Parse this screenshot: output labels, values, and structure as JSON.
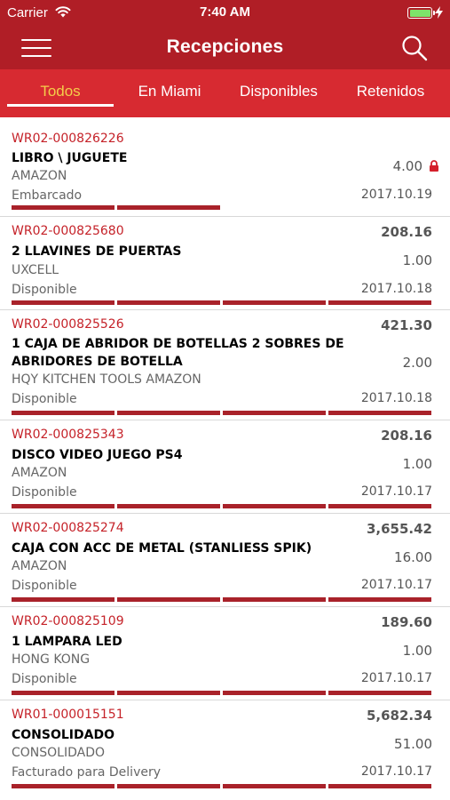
{
  "status_bar": {
    "carrier": "Carrier",
    "time": "7:40 AM",
    "battery_color": "#7de36a"
  },
  "header": {
    "title": "Recepciones",
    "menu_icon": "hamburger-menu-icon",
    "search_icon": "search-icon",
    "background_color": "#b01e26"
  },
  "tabs": [
    {
      "label": "Todos",
      "active": true
    },
    {
      "label": "En Miami",
      "active": false
    },
    {
      "label": "Disponibles",
      "active": false
    },
    {
      "label": "Retenidos",
      "active": false
    }
  ],
  "colors": {
    "tab_bar": "#d72a31",
    "active_tab_text": "#f4cd4a",
    "code_text": "#c52229",
    "progress": "#a9222a"
  },
  "receptions": [
    {
      "code": "WR02-000826226",
      "description": "LIBRO \\ JUGUETE",
      "supplier": "AMAZON",
      "status": "Embarcado",
      "amount": "",
      "quantity": "4.00",
      "locked": true,
      "date": "2017.10.19",
      "progress_steps": 2
    },
    {
      "code": "WR02-000825680",
      "description": "2 LLAVINES DE PUERTAS",
      "supplier": "UXCELL",
      "status": "Disponible",
      "amount": "208.16",
      "quantity": "1.00",
      "locked": false,
      "date": "2017.10.18",
      "progress_steps": 4
    },
    {
      "code": "WR02-000825526",
      "description": "1 CAJA DE ABRIDOR DE BOTELLAS 2 SOBRES DE ABRIDORES DE BOTELLA",
      "supplier": "HQY KITCHEN TOOLS AMAZON",
      "status": "Disponible",
      "amount": "421.30",
      "quantity": "2.00",
      "locked": false,
      "date": "2017.10.18",
      "progress_steps": 4
    },
    {
      "code": "WR02-000825343",
      "description": "DISCO VIDEO JUEGO PS4",
      "supplier": "AMAZON",
      "status": "Disponible",
      "amount": "208.16",
      "quantity": "1.00",
      "locked": false,
      "date": "2017.10.17",
      "progress_steps": 4
    },
    {
      "code": "WR02-000825274",
      "description": "CAJA CON ACC DE METAL (STANLIESS SPIK)",
      "supplier": "AMAZON",
      "status": "Disponible",
      "amount": "3,655.42",
      "quantity": "16.00",
      "locked": false,
      "date": "2017.10.17",
      "progress_steps": 4
    },
    {
      "code": "WR02-000825109",
      "description": "1 LAMPARA LED",
      "supplier": "HONG KONG",
      "status": "Disponible",
      "amount": "189.60",
      "quantity": "1.00",
      "locked": false,
      "date": "2017.10.17",
      "progress_steps": 4
    },
    {
      "code": "WR01-000015151",
      "description": "CONSOLIDADO",
      "supplier": "CONSOLIDADO",
      "status": "Facturado para Delivery",
      "amount": "5,682.34",
      "quantity": "51.00",
      "locked": false,
      "date": "2017.10.17",
      "progress_steps": 4
    }
  ]
}
